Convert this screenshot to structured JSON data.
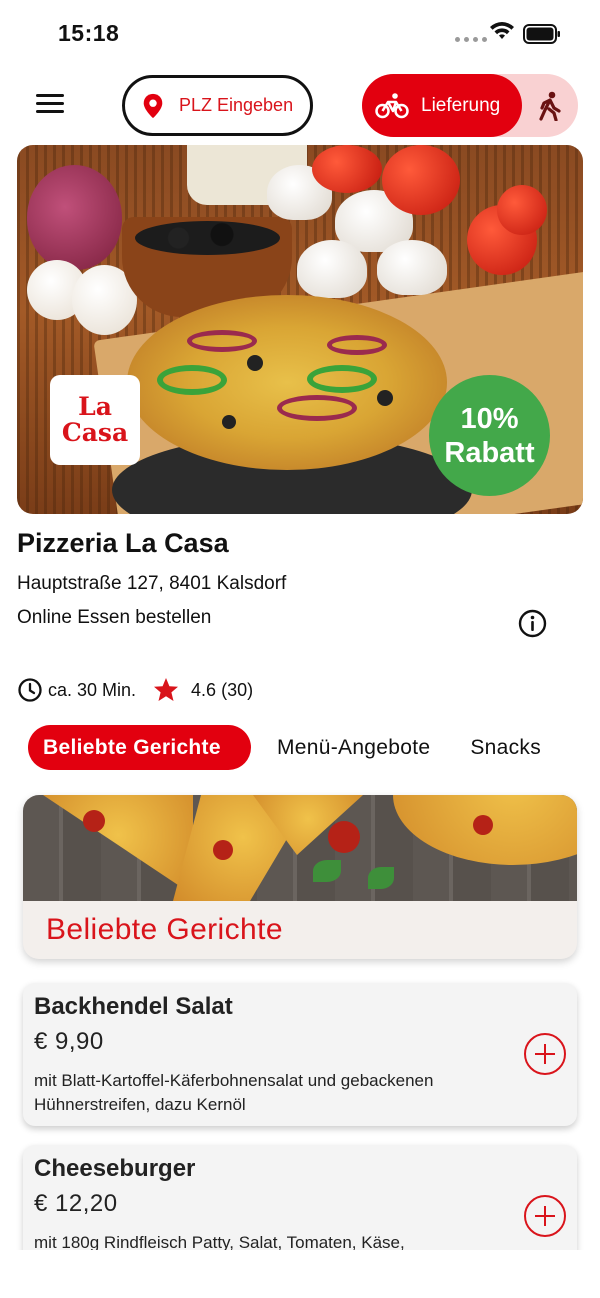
{
  "status_bar": {
    "time": "15:18"
  },
  "header": {
    "plz_label": "PLZ Eingeben",
    "delivery_label": "Lieferung",
    "active_mode": "delivery",
    "icons": [
      "menu-icon",
      "location-pin-icon",
      "bike-icon",
      "walk-icon"
    ]
  },
  "hero": {
    "logo_line1": "La",
    "logo_line2": "Casa",
    "discount_percent": "10%",
    "discount_word": "Rabatt"
  },
  "restaurant": {
    "name": "Pizzeria La Casa",
    "address": "Hauptstraße 127, 8401 Kalsdorf",
    "tagline": "Online Essen bestellen",
    "delivery_time": "ca. 30 Min.",
    "rating": "4.6 (30)"
  },
  "tabs": [
    {
      "label": "Beliebte Gerichte",
      "active": true
    },
    {
      "label": "Menü-Angebote",
      "active": false
    },
    {
      "label": "Snacks",
      "active": false
    }
  ],
  "category": {
    "title": "Beliebte Gerichte"
  },
  "dishes": [
    {
      "name": "Backhendel Salat",
      "price": "€ 9,90",
      "description": "mit Blatt-Kartoffel-Käferbohnensalat und gebackenen Hühnerstreifen, dazu Kernöl"
    },
    {
      "name": "Cheeseburger",
      "price": "€ 12,20",
      "description": "mit 180g Rindfleisch Patty, Salat, Tomaten, Käse,"
    }
  ],
  "colors": {
    "accent": "#e2000f",
    "accent_light": "#f9d1d2",
    "discount_green": "#43a84a"
  }
}
